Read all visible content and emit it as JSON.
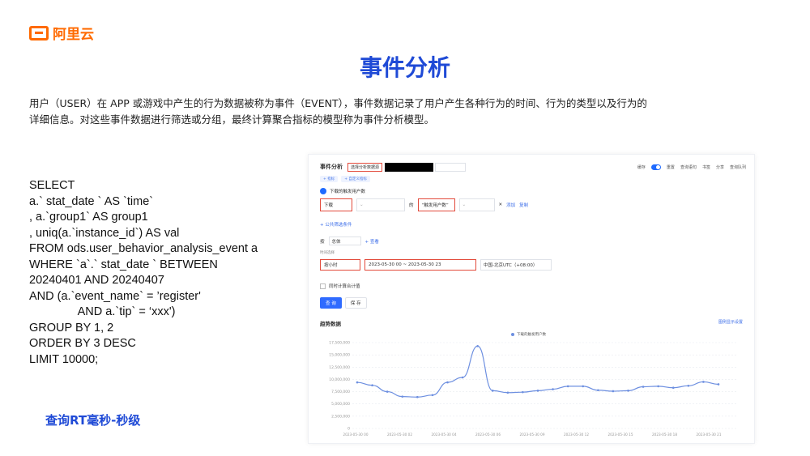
{
  "brand": {
    "logo_text": "阿里云",
    "color": "#ff6a00"
  },
  "page": {
    "title": "事件分析",
    "intro_line1": "用户（USER）在 APP 或游戏中产生的行为数据被称为事件（EVENT），事件数据记录了用户产生各种行为的时间、行为的类型以及行为的",
    "intro_line2": "详细信息。对这些事件数据进行筛选或分组，最终计算聚合指标的模型称为事件分析模型。",
    "footer_note": "查询RT毫秒-秒级",
    "accent": "#1f4ad6"
  },
  "sql": [
    "SELECT",
    "a.` stat_date ` AS `time`",
    ", a.`group1` AS group1",
    ", uniq(a.`instance_id`) AS val",
    "FROM ods.user_behavior_analysis_event a",
    "WHERE `a`.` stat_date ` BETWEEN",
    "20240401 AND 20240407",
    "AND (a.`event_name` = ’register'",
    "               AND a.`tip` = ‘xxx')",
    "GROUP BY 1, 2",
    "ORDER BY 3 DESC",
    "LIMIT 10000;"
  ],
  "app": {
    "title": "事件分析",
    "selector_label": "选择分析数据源",
    "header_actions": [
      "缓存",
      "重置",
      "查询语句",
      "书签",
      "分享",
      "查询队列"
    ],
    "tab_chips": [
      "+ 指标",
      "+ 自定义指标"
    ],
    "metric_name": "下载的触发用户数",
    "event_value": "下载",
    "event_of": "的",
    "event_metric": "“触发用户数”",
    "add_filter": "添加",
    "copy": "复制",
    "common_filter": "+ 公共筛选条件",
    "group_by_label": "按",
    "group_by_value": "总体",
    "group_add": "+ 查看",
    "time_section": "时间选择",
    "granularity": "按小时",
    "date_range": "2023-05-30 00 ~ 2023-05-30 23",
    "timezone": "中国-北京UTC（+08:00）",
    "cumulative_label": "同时计算合计值",
    "query_button": "查 询",
    "save_button": "保 存",
    "trend_title": "趋势数据",
    "trend_setting": "图例显示设置"
  },
  "chart_data": {
    "type": "line",
    "title": "",
    "xlabel": "",
    "ylabel": "",
    "y_ticks": [
      "0",
      "2,500,000",
      "5,000,000",
      "7,500,000",
      "10,000,000",
      "12,500,000",
      "15,000,000",
      "17,500,000"
    ],
    "ylim": [
      0,
      17500000
    ],
    "x_tick_labels": [
      "2023-05-30 00",
      "2023-05-30 02",
      "2023-05-30 04",
      "2023-05-30 06",
      "2023-05-30 09",
      "2023-05-30 12",
      "2023-05-30 15",
      "2023-05-30 18",
      "2023-05-30 21"
    ],
    "series": [
      {
        "name": "下载的触发用户数",
        "color": "#6d8fe0",
        "values": [
          9400000,
          8800000,
          7500000,
          6500000,
          6400000,
          6800000,
          9400000,
          10400000,
          16800000,
          7700000,
          7300000,
          7400000,
          7700000,
          8000000,
          8600000,
          8600000,
          7800000,
          7600000,
          7700000,
          8500000,
          8600000,
          8300000,
          8700000,
          9500000,
          9000000
        ]
      }
    ]
  }
}
